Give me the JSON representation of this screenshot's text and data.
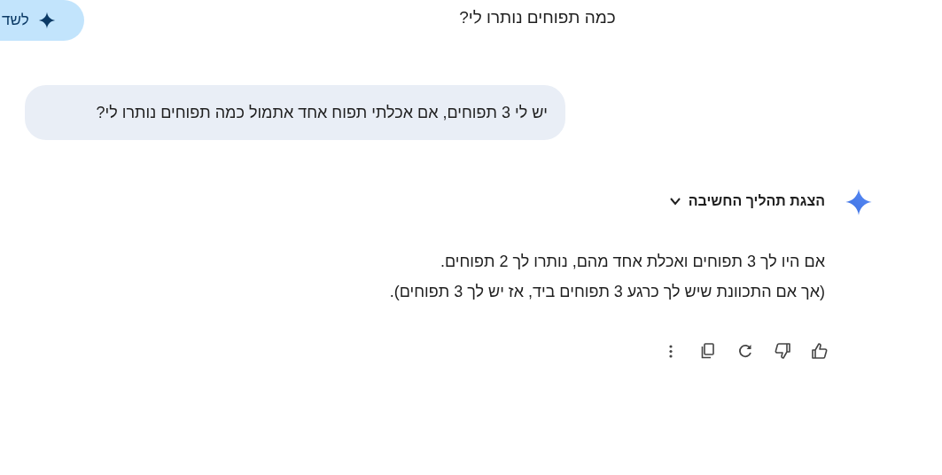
{
  "top_bar": {
    "side_button": {
      "label": "לשד"
    },
    "title": "כמה תפוחים נותרו לי?"
  },
  "user_message": "יש לי 3 תפוחים, אם אכלתי תפוח אחד אתמול כמה תפוחים נותרו לי?",
  "thinking": {
    "label": "הצגת תהליך החשיבה",
    "expanded": false
  },
  "response": [
    "אם היו לך 3 תפוחים ואכלת אחד מהם, נותרו לך 2 תפוחים.",
    "(אך אם התכוונת שיש לך כרגע 3 תפוחים ביד, אז יש לך 3 תפוחים)."
  ]
}
